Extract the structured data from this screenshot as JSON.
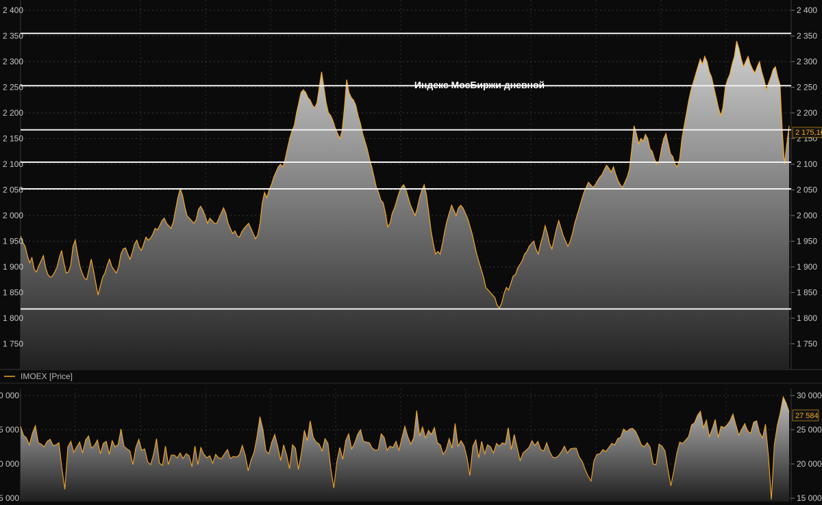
{
  "chart_data": [
    {
      "type": "area",
      "title": "Индекс МосБиржи дневной",
      "legend": {
        "label": "IMOEX [Price]",
        "placement": "bottom-left"
      },
      "series_color": "#f5a623",
      "ylim": [
        1700,
        2420
      ],
      "yticks": [
        1750,
        1800,
        1850,
        1900,
        1950,
        2000,
        2050,
        2100,
        2150,
        2200,
        2250,
        2300,
        2350,
        2400
      ],
      "ytick_labels": [
        "1 750",
        "1 800",
        "1 850",
        "1 900",
        "1 950",
        "2 000",
        "2 050",
        "2 100",
        "2 150",
        "2 200",
        "2 250",
        "2 300",
        "2 350",
        "2 400"
      ],
      "last_value_label": "2 175,16",
      "last_value": 2175.16,
      "horizontal_levels": [
        2355,
        2253,
        2167,
        2104,
        2052,
        1818
      ],
      "grid": true,
      "values": [
        1960,
        1948,
        1940,
        1922,
        1908,
        1918,
        1895,
        1890,
        1902,
        1912,
        1922,
        1898,
        1885,
        1880,
        1882,
        1890,
        1900,
        1918,
        1932,
        1908,
        1888,
        1890,
        1903,
        1940,
        1952,
        1925,
        1902,
        1888,
        1878,
        1875,
        1895,
        1915,
        1893,
        1868,
        1845,
        1863,
        1880,
        1888,
        1903,
        1915,
        1901,
        1894,
        1888,
        1900,
        1925,
        1935,
        1937,
        1925,
        1915,
        1928,
        1945,
        1952,
        1938,
        1932,
        1945,
        1958,
        1952,
        1956,
        1964,
        1975,
        1972,
        1980,
        1990,
        1995,
        1985,
        1980,
        1975,
        1988,
        2012,
        2035,
        2052,
        2040,
        2018,
        2000,
        1995,
        1990,
        1985,
        1992,
        2012,
        2018,
        2010,
        1998,
        1985,
        1995,
        1990,
        1985,
        1985,
        1995,
        2005,
        2015,
        2005,
        1985,
        1975,
        1965,
        1970,
        1960,
        1958,
        1968,
        1975,
        1980,
        1985,
        1975,
        1965,
        1955,
        1962,
        1985,
        2025,
        2045,
        2035,
        2050,
        2060,
        2075,
        2085,
        2095,
        2100,
        2095,
        2110,
        2130,
        2150,
        2165,
        2175,
        2200,
        2220,
        2240,
        2245,
        2240,
        2230,
        2225,
        2215,
        2210,
        2220,
        2250,
        2280,
        2250,
        2220,
        2200,
        2195,
        2185,
        2170,
        2160,
        2150,
        2165,
        2210,
        2265,
        2240,
        2230,
        2225,
        2215,
        2195,
        2180,
        2160,
        2145,
        2130,
        2110,
        2095,
        2075,
        2055,
        2045,
        2030,
        2025,
        2005,
        1978,
        1985,
        2005,
        2015,
        2030,
        2045,
        2055,
        2060,
        2050,
        2035,
        2020,
        2010,
        2000,
        2015,
        2035,
        2050,
        2060,
        2040,
        2005,
        1970,
        1945,
        1925,
        1930,
        1925,
        1945,
        1970,
        1990,
        2005,
        2020,
        2010,
        2000,
        2015,
        2020,
        2015,
        2005,
        1995,
        1980,
        1965,
        1945,
        1925,
        1910,
        1895,
        1880,
        1860,
        1855,
        1850,
        1845,
        1840,
        1825,
        1820,
        1830,
        1848,
        1860,
        1855,
        1868,
        1882,
        1885,
        1898,
        1905,
        1912,
        1925,
        1930,
        1940,
        1945,
        1950,
        1935,
        1925,
        1945,
        1960,
        1980,
        1965,
        1945,
        1935,
        1955,
        1975,
        1990,
        1975,
        1960,
        1950,
        1940,
        1950,
        1965,
        1985,
        2000,
        2015,
        2030,
        2045,
        2055,
        2065,
        2060,
        2055,
        2060,
        2068,
        2075,
        2080,
        2090,
        2098,
        2092,
        2085,
        2095,
        2080,
        2068,
        2060,
        2055,
        2065,
        2075,
        2090,
        2130,
        2175,
        2160,
        2140,
        2150,
        2145,
        2158,
        2150,
        2130,
        2125,
        2110,
        2100,
        2105,
        2130,
        2150,
        2160,
        2140,
        2120,
        2115,
        2100,
        2095,
        2110,
        2150,
        2175,
        2200,
        2225,
        2245,
        2260,
        2275,
        2290,
        2305,
        2295,
        2310,
        2300,
        2280,
        2270,
        2250,
        2230,
        2210,
        2195,
        2210,
        2250,
        2265,
        2275,
        2295,
        2310,
        2340,
        2325,
        2305,
        2290,
        2300,
        2310,
        2295,
        2285,
        2278,
        2290,
        2300,
        2280,
        2265,
        2245,
        2258,
        2270,
        2285,
        2290,
        2270,
        2255,
        2165,
        2100,
        2140,
        2175
      ]
    },
    {
      "type": "area",
      "title": "",
      "series_color": "#f5a623",
      "ylim": [
        14500,
        31000
      ],
      "yticks": [
        15000,
        20000,
        25000,
        30000
      ],
      "ytick_labels": [
        "15 000",
        "20 000",
        "25 000",
        "30 000"
      ],
      "left_tick_labels": [
        "0 000",
        "5 000",
        "0 000",
        "5 000"
      ],
      "last_value_label": "27 584",
      "last_value": 27584,
      "grid": true,
      "values": [
        25500,
        24200,
        23800,
        22800,
        24500,
        25600,
        23100,
        22900,
        22500,
        23300,
        23600,
        22700,
        22800,
        23100,
        19300,
        16300,
        22500,
        23300,
        21700,
        22500,
        23200,
        21600,
        23500,
        24100,
        22300,
        22700,
        23500,
        21500,
        23000,
        23300,
        21400,
        23400,
        22500,
        22800,
        25100,
        22600,
        22200,
        21900,
        19900,
        22400,
        23600,
        22000,
        22200,
        20300,
        19900,
        21400,
        23700,
        20100,
        19800,
        22600,
        19900,
        21300,
        21300,
        20900,
        21600,
        20800,
        21500,
        21200,
        19600,
        22600,
        19900,
        22400,
        21400,
        20900,
        21200,
        20100,
        21400,
        20900,
        20800,
        21500,
        22100,
        20800,
        21100,
        21000,
        21300,
        22700,
        21300,
        19000,
        20600,
        21700,
        24000,
        26900,
        25000,
        21900,
        21500,
        23200,
        24300,
        22600,
        20500,
        22800,
        21300,
        19300,
        22800,
        22300,
        19200,
        21600,
        24900,
        23400,
        26300,
        23900,
        23200,
        22900,
        21900,
        23700,
        23000,
        19200,
        16500,
        20300,
        22400,
        20700,
        23400,
        24400,
        22200,
        23000,
        24300,
        25000,
        23300,
        23200,
        23100,
        22300,
        22000,
        22100,
        24400,
        23900,
        22000,
        22600,
        22400,
        23300,
        22000,
        23800,
        25500,
        24000,
        22900,
        23800,
        27800,
        24100,
        25400,
        23800,
        24900,
        24300,
        25300,
        23100,
        22800,
        21400,
        22100,
        23700,
        22300,
        25900,
        22600,
        23400,
        22700,
        21000,
        18300,
        22600,
        23500,
        20900,
        23300,
        21500,
        22800,
        22500,
        21600,
        23000,
        22600,
        23100,
        22900,
        25300,
        22100,
        24300,
        22400,
        20500,
        21600,
        22000,
        22400,
        23400,
        22700,
        23300,
        22100,
        21900,
        23100,
        21800,
        21000,
        20900,
        21200,
        21800,
        22600,
        21600,
        22200,
        22300,
        22300,
        21000,
        20400,
        19200,
        18200,
        17500,
        20500,
        21400,
        21500,
        22100,
        21800,
        22400,
        23000,
        22800,
        23700,
        23900,
        25100,
        24700,
        25100,
        25200,
        24800,
        23900,
        22800,
        22500,
        23100,
        22400,
        20000,
        19900,
        22900,
        22600,
        21900,
        19200,
        16800,
        19000,
        21500,
        23200,
        23000,
        23500,
        24000,
        25700,
        26000,
        27100,
        27700,
        25300,
        26400,
        24000,
        25100,
        26500,
        23900,
        25500,
        25300,
        25700,
        26300,
        27300,
        25700,
        24200,
        25100,
        25900,
        24800,
        24500,
        26100,
        26300,
        24600,
        23800,
        25800,
        21200,
        14800,
        22800,
        25600,
        27500,
        29800,
        28900,
        27584
      ]
    }
  ]
}
